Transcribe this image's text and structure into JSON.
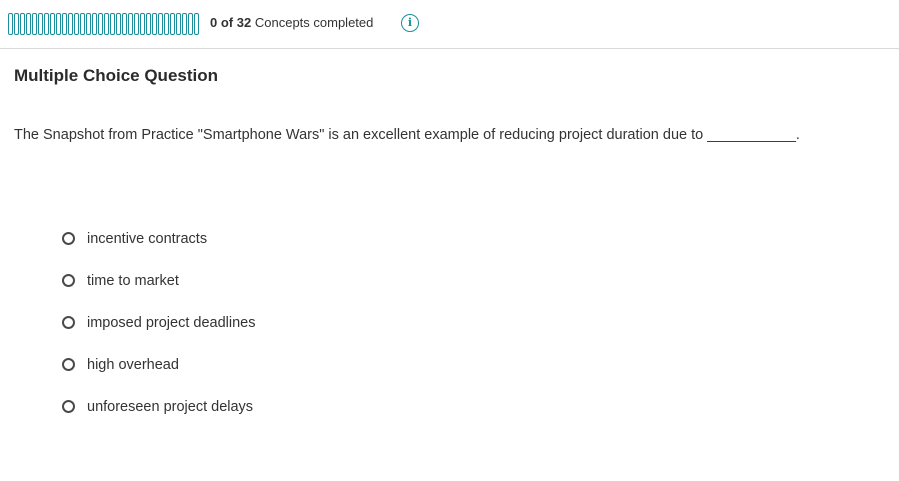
{
  "progress": {
    "completed": "0",
    "of_text": "of",
    "total": "32",
    "label": "Concepts completed",
    "segments_total": 32,
    "segments_completed": 0,
    "accent_color": "#1a8f9b"
  },
  "info_icon": "info-icon",
  "question": {
    "title": "Multiple Choice Question",
    "text": "The Snapshot from Practice \"Smartphone Wars\" is an excellent example of reducing project duration due to ___________.",
    "options": [
      {
        "label": "incentive contracts"
      },
      {
        "label": "time to market"
      },
      {
        "label": "imposed project deadlines"
      },
      {
        "label": "high overhead"
      },
      {
        "label": "unforeseen project delays"
      }
    ]
  }
}
